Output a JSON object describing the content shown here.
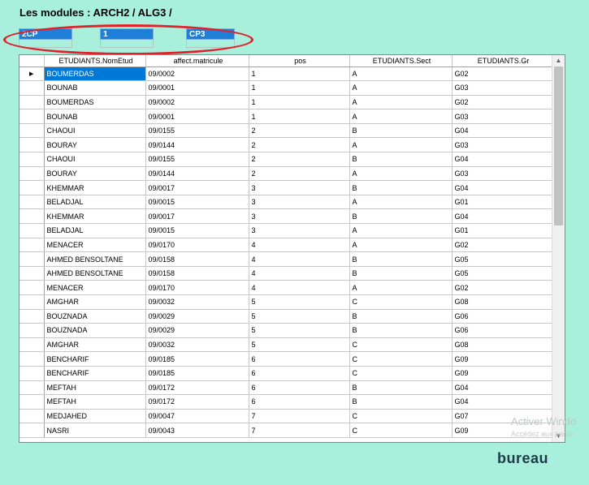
{
  "header": {
    "title": "Les modules : ARCH2 / ALG3 /"
  },
  "chips": [
    {
      "label": "2CP"
    },
    {
      "label": "1"
    },
    {
      "label": "CP3"
    }
  ],
  "grid": {
    "columns": [
      "ETUDIANTS.NomEtud",
      "affect.matricule",
      "pos",
      "ETUDIANTS.Sect",
      "ETUDIANTS.Gr"
    ],
    "current_row_marker": "▶",
    "rows": [
      [
        "BOUMERDAS",
        "09/0002",
        "1",
        "A",
        "G02"
      ],
      [
        "BOUNAB",
        "09/0001",
        "1",
        "A",
        "G03"
      ],
      [
        "BOUMERDAS",
        "09/0002",
        "1",
        "A",
        "G02"
      ],
      [
        "BOUNAB",
        "09/0001",
        "1",
        "A",
        "G03"
      ],
      [
        "CHAOUI",
        "09/0155",
        "2",
        "B",
        "G04"
      ],
      [
        "BOURAY",
        "09/0144",
        "2",
        "A",
        "G03"
      ],
      [
        "CHAOUI",
        "09/0155",
        "2",
        "B",
        "G04"
      ],
      [
        "BOURAY",
        "09/0144",
        "2",
        "A",
        "G03"
      ],
      [
        "KHEMMAR",
        "09/0017",
        "3",
        "B",
        "G04"
      ],
      [
        "BELADJAL",
        "09/0015",
        "3",
        "A",
        "G01"
      ],
      [
        "KHEMMAR",
        "09/0017",
        "3",
        "B",
        "G04"
      ],
      [
        "BELADJAL",
        "09/0015",
        "3",
        "A",
        "G01"
      ],
      [
        "MENACER",
        "09/0170",
        "4",
        "A",
        "G02"
      ],
      [
        "AHMED BENSOLTANE",
        "09/0158",
        "4",
        "B",
        "G05"
      ],
      [
        "AHMED BENSOLTANE",
        "09/0158",
        "4",
        "B",
        "G05"
      ],
      [
        "MENACER",
        "09/0170",
        "4",
        "A",
        "G02"
      ],
      [
        "AMGHAR",
        "09/0032",
        "5",
        "C",
        "G08"
      ],
      [
        "BOUZNADA",
        "09/0029",
        "5",
        "B",
        "G06"
      ],
      [
        "BOUZNADA",
        "09/0029",
        "5",
        "B",
        "G06"
      ],
      [
        "AMGHAR",
        "09/0032",
        "5",
        "C",
        "G08"
      ],
      [
        "BENCHARIF",
        "09/0185",
        "6",
        "C",
        "G09"
      ],
      [
        "BENCHARIF",
        "09/0185",
        "6",
        "C",
        "G09"
      ],
      [
        "MEFTAH",
        "09/0172",
        "6",
        "B",
        "G04"
      ],
      [
        "MEFTAH",
        "09/0172",
        "6",
        "B",
        "G04"
      ],
      [
        "MEDJAHED",
        "09/0047",
        "7",
        "C",
        "G07"
      ],
      [
        "NASRI",
        "09/0043",
        "7",
        "C",
        "G09"
      ]
    ]
  },
  "watermark": {
    "line1": "Activer Windo",
    "line2": "Accédez aux paran"
  },
  "footer": {
    "label": "bureau"
  },
  "colors": {
    "background": "#a8f0dc",
    "selection": "#0078d7",
    "highlight_ellipse": "#e0202a",
    "chip": "#1e7fd8"
  }
}
